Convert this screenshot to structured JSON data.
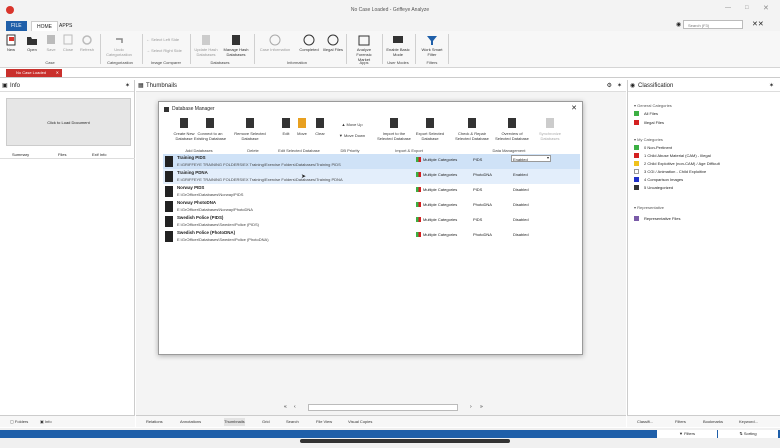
{
  "window": {
    "title": "No Case Loaded - Griffeye Analyze",
    "search_placeholder": "Search (F3)"
  },
  "menu_tabs": [
    "FILE",
    "HOME",
    "APPS"
  ],
  "ribbon": {
    "buttons": [
      "New",
      "Open",
      "Save",
      "Close",
      "Refresh",
      "Undo Categorization",
      "Select Left Side",
      "Select Right Side",
      "Update Hash Databases",
      "Manage Hash Databases",
      "Case Information",
      "Completed",
      "Illegal Files",
      "Analyze Forensic Market",
      "Enable Basic Mode",
      "Work Smart Filter"
    ],
    "groups": [
      "Case",
      "Categorization",
      "Image Comparer",
      "Databases",
      "Information",
      "Apps",
      "User Modes",
      "Filters"
    ]
  },
  "case_tab": "No Case Loaded",
  "info_pane": {
    "title": "Info",
    "load_text": "Click to Load Document",
    "tabs": [
      "Summary",
      "Files",
      "Exif Info"
    ]
  },
  "thumbnails_pane": {
    "title": "Thumbnails"
  },
  "classification": {
    "title": "Classification",
    "general_header": "General Categories",
    "general": [
      "All Files",
      "Illegal Files"
    ],
    "my_header": "My Categories",
    "my": [
      {
        "label": "0  Non-Pertinent",
        "color": "#3cb043"
      },
      {
        "label": "1  Child Abuse Material (CAM) - Illegal",
        "color": "#d42020"
      },
      {
        "label": "2  Child Exploitive (non-CAM) / Age Difficult",
        "color": "#f0c21c"
      },
      {
        "label": "3  CGI / Animation - Child Exploitive",
        "color": "#ffffff"
      },
      {
        "label": "4  Comparison Images",
        "color": "#2030c8"
      },
      {
        "label": "5  Uncategorized",
        "color": "#333333"
      }
    ],
    "rep_header": "Representative",
    "rep": [
      "Representative Files"
    ]
  },
  "dialog": {
    "title": "Database Manager",
    "buttons": [
      "Create New Database",
      "Connect to an Existing Database",
      "Remove Selected Database",
      "Edit",
      "Move",
      "Clear",
      "Move Up",
      "Move Down",
      "Import to the Selected Database",
      "Export Selected Database",
      "Check & Repair Selected Database",
      "Overview of Selected Database",
      "Synchronize Databases"
    ],
    "groups": [
      "Add Databases",
      "Delete",
      "Edit Selected Database",
      "DB Priority",
      "Import & Export",
      "Data Management"
    ],
    "rows": [
      {
        "name": "Training PIDS",
        "path": "E:\\GRIFFEYE TRAINING FOLDERS\\EX Training\\Exercise Folders\\Databases\\Training PIDS",
        "cat": "Multiple Categories",
        "type": "PIDS",
        "status": "Enabled"
      },
      {
        "name": "Training PDNA",
        "path": "E:\\GRIFFEYE TRAINING FOLDERS\\EX Training\\Exercise Folders\\Databases\\Training PDNA",
        "cat": "Multiple Categories",
        "type": "PhotoDNA",
        "status": "Enabled"
      },
      {
        "name": "Norway PIDS",
        "path": "E:\\GrOfficer\\Databases\\Norway\\PIDS",
        "cat": "Multiple Categories",
        "type": "PIDS",
        "status": "Disabled"
      },
      {
        "name": "Norway PhotoDNA",
        "path": "E:\\GrOfficer\\Databases\\Norway\\PhotoDNA",
        "cat": "Multiple Categories",
        "type": "PhotoDNA",
        "status": "Disabled"
      },
      {
        "name": "Swedish Police (PIDS)",
        "path": "E:\\GrOfficer\\Databases\\Sweden\\Police (PIDS)",
        "cat": "Multiple Categories",
        "type": "PIDS",
        "status": "Disabled"
      },
      {
        "name": "Swedish Police (PhotoDNA)",
        "path": "E:\\GrOfficer\\Databases\\Sweden\\Police (PhotoDNA)",
        "cat": "Multiple Categories",
        "type": "PhotoDNA",
        "status": "Disabled"
      }
    ]
  },
  "bottom_left_tabs": [
    "Folders",
    "Info"
  ],
  "bottom_center_tabs": [
    "Relations",
    "Annotations",
    "Thumbnails",
    "Grid",
    "Search",
    "File View",
    "Visual Copies"
  ],
  "bottom_right_tabs": [
    "Classifi...",
    "Filters",
    "Bookmarks",
    "Keyword..."
  ],
  "status": {
    "filters": "Filters",
    "sorting": "Sorting"
  }
}
